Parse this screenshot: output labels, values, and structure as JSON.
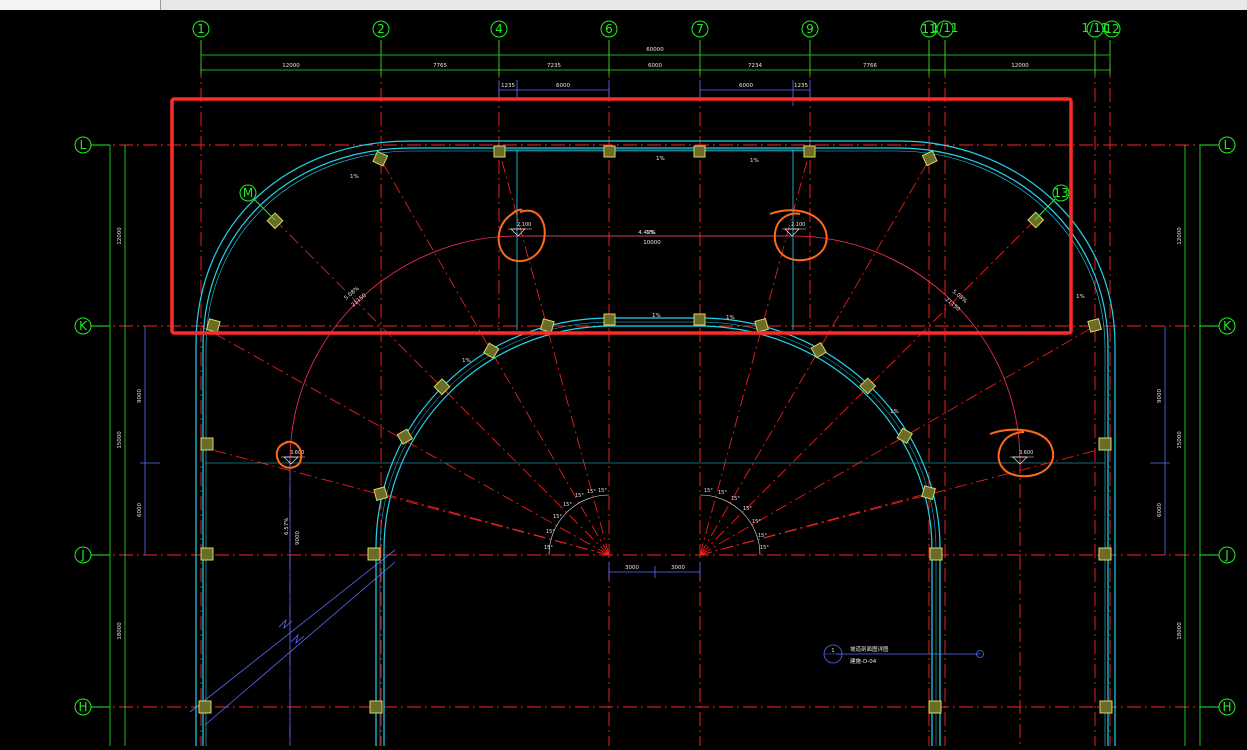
{
  "grid_axes_top": [
    "1",
    "2",
    "4",
    "6",
    "7",
    "9",
    "11",
    "1/11",
    "1/11",
    "12"
  ],
  "grid_axes_side": [
    "L",
    "K",
    "J",
    "H"
  ],
  "radial_axes": [
    "M",
    "13"
  ],
  "dims_top": {
    "total": "60000",
    "segments": [
      "12000",
      "7765",
      "7235",
      "6000",
      "7234",
      "7766",
      "12000"
    ],
    "inner_left": [
      "1235",
      "6000"
    ],
    "inner_right": [
      "6000",
      "1235"
    ]
  },
  "dims_side_left": [
    "12000",
    "9000",
    "15000",
    "6000",
    "18000"
  ],
  "dims_side_right": [
    "12000",
    "9000",
    "15000",
    "6000",
    "18000"
  ],
  "dims_bottom_center": [
    "3000",
    "3000"
  ],
  "slope_labels": [
    "1%",
    "1%",
    "1%",
    "1%",
    "1%",
    "1%",
    "1%",
    "1%",
    "1%"
  ],
  "ramp_labels": [
    "5.08%",
    "21150",
    "5.08%",
    "21150",
    "4.49%",
    "10000",
    "6.57%",
    "9000"
  ],
  "angles_left": [
    "15°",
    "15°",
    "15°",
    "15°",
    "15°",
    "15°",
    "15°"
  ],
  "angles_right": [
    "15°",
    "15°",
    "15°",
    "15°",
    "15°",
    "15°",
    "15°"
  ],
  "elevations": [
    "2.100",
    "2.100",
    "3.600",
    "3.600"
  ],
  "section_symbol": {
    "number": "1",
    "title": "坡道剖面图详图",
    "ref": "建施-D-04"
  },
  "colors": {
    "grid": "#22ee22",
    "axis": "#ff2222",
    "wall": "#22d3ee",
    "dim": "#5a6aff",
    "column": "#c8c850",
    "highlight": "#ff2a2a",
    "circle_mark": "#ff6a1a"
  }
}
